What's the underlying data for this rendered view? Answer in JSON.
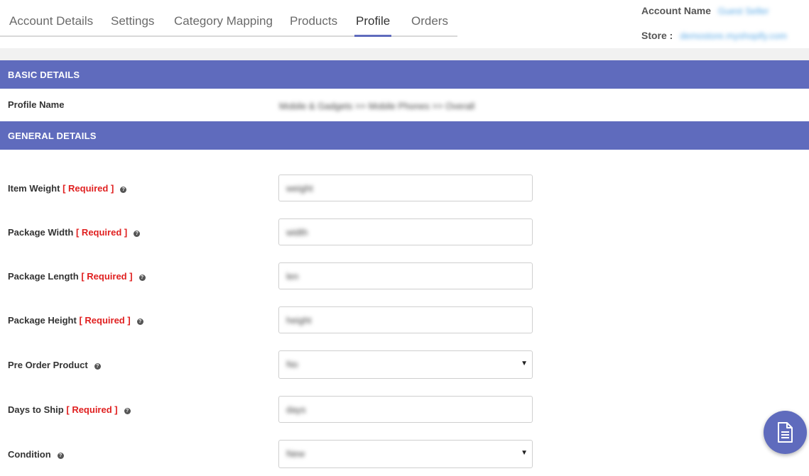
{
  "tabs": [
    {
      "label": "Account Details",
      "active": false
    },
    {
      "label": "Settings",
      "active": false
    },
    {
      "label": "Category Mapping",
      "active": false
    },
    {
      "label": "Products",
      "active": false
    },
    {
      "label": "Profile",
      "active": true
    },
    {
      "label": "Orders",
      "active": false
    }
  ],
  "header": {
    "account_label": "Account Name",
    "account_value": "Guest Seller",
    "store_label": "Store :",
    "store_value": "demostore.myshopify.com"
  },
  "sections": {
    "basic": "BASIC DETAILS",
    "general": "GENERAL DETAILS"
  },
  "profile": {
    "label": "Profile Name",
    "value": "Mobile & Gadgets >> Mobile Phones >> Overall"
  },
  "required_text": "[ Required ]",
  "help_glyph": "?",
  "fields": [
    {
      "label": "Item Weight",
      "required": true,
      "type": "input",
      "value": "weight"
    },
    {
      "label": "Package Width",
      "required": true,
      "type": "input",
      "value": "width"
    },
    {
      "label": "Package Length",
      "required": true,
      "type": "input",
      "value": "len"
    },
    {
      "label": "Package Height",
      "required": true,
      "type": "input",
      "value": "height"
    },
    {
      "label": "Pre Order Product",
      "required": false,
      "type": "select",
      "value": "No"
    },
    {
      "label": "Days to Ship",
      "required": true,
      "type": "input",
      "value": "days"
    },
    {
      "label": "Condition",
      "required": false,
      "type": "select",
      "value": "New"
    }
  ],
  "colors": {
    "accent": "#5f6bbd",
    "required": "#e02020"
  },
  "fab_icon": "document-icon"
}
